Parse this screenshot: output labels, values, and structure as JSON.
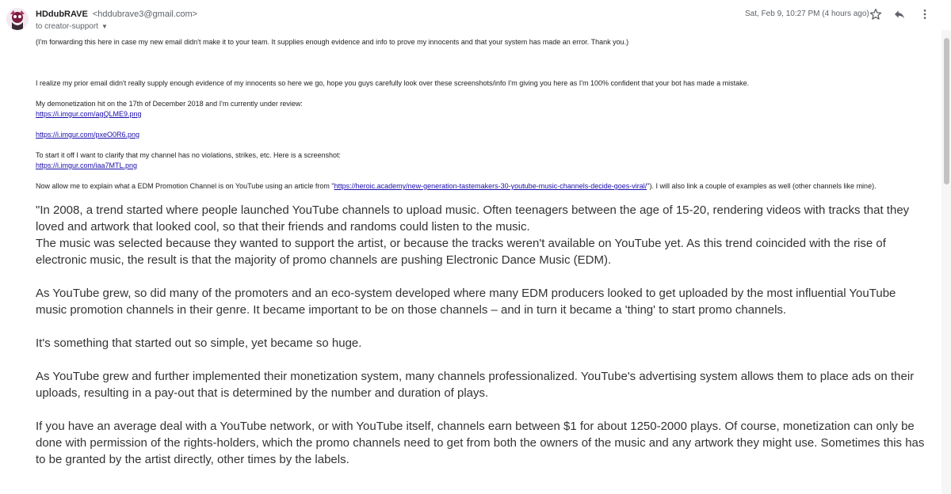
{
  "header": {
    "sender_name": "HDdubRAVE",
    "sender_email": "<hddubrave3@gmail.com>",
    "recipient": "to creator-support",
    "timestamp": "Sat, Feb 9, 10:27 PM (4 hours ago)"
  },
  "icons": {
    "avatar": "avatar-icon",
    "star": "star-icon",
    "reply": "reply-icon",
    "more": "more-vertical-icon",
    "caret": "chevron-down-icon"
  },
  "colors": {
    "link": "#1a0dab",
    "meta": "#5f6368"
  },
  "message": {
    "intro": "(I'm forwarding this here in case my new email didn't make it to your team. It supplies enough evidence and info to prove my innocents and that your system has made an error. Thank you.)",
    "p1": "I realize my prior email didn't really supply enough evidence of my innocents so here we go, hope you guys carefully look over these screenshots/info I'm giving you here as I'm 100% confident that your bot has made a mistake.",
    "p2": "My demonetization hit on the 17th of December 2018 and I'm currently under review:",
    "link1": "https://i.imgur.com/agQLME9.png",
    "link2": "https://i.imgur.com/pxeO0R6.png",
    "p3": "To start it off I want to clarify that my channel has no violations, strikes, etc. Here is a screenshot:",
    "link3": "https://i.imgur.com/iaa7MTL.png",
    "p4_before": "Now allow me to explain what a EDM Promotion Channel is on YouTube using an article from \"",
    "link4": "https://heroic.academy/new-generation-tastemakers-30-youtube-music-channels-decide-goes-viral/",
    "p4_after": "\"). I will also link a couple of examples as well (other channels like mine).",
    "q1a": "\"In 2008, a trend started where people launched YouTube channels to upload music. Often teenagers between the age of 15-20, rendering videos with tracks that they loved and artwork that looked cool, so that their friends and randoms could listen to the music.",
    "q1b": "The music was selected because they wanted to support the artist, or because the tracks weren't available on YouTube yet. As this trend coincided with the rise of electronic music, the result is that the majority of promo channels are pushing Electronic Dance Music (EDM).",
    "q2": "As YouTube grew, so did many of the promoters and an eco-system developed where many EDM producers looked to get uploaded by the most influential YouTube music promotion channels in their genre. It became important to be on those channels – and in turn it became a 'thing' to start promo channels.",
    "q3": "It's something that started out so simple, yet became so huge.",
    "q4": "As YouTube grew and further implemented their monetization system, many channels professionalized. YouTube's advertising system allows them to place ads on their uploads, resulting in a pay-out that is determined by the number and duration of plays.",
    "q5": "If you have an average deal with a YouTube network, or with YouTube itself, channels earn between $1 for about 1250-2000 plays. Of course, monetization can only be done with permission of the rights-holders, which the promo channels need to get from both the owners of the music and any artwork they might use. Sometimes this has to be granted by the artist directly, other times by the labels."
  }
}
